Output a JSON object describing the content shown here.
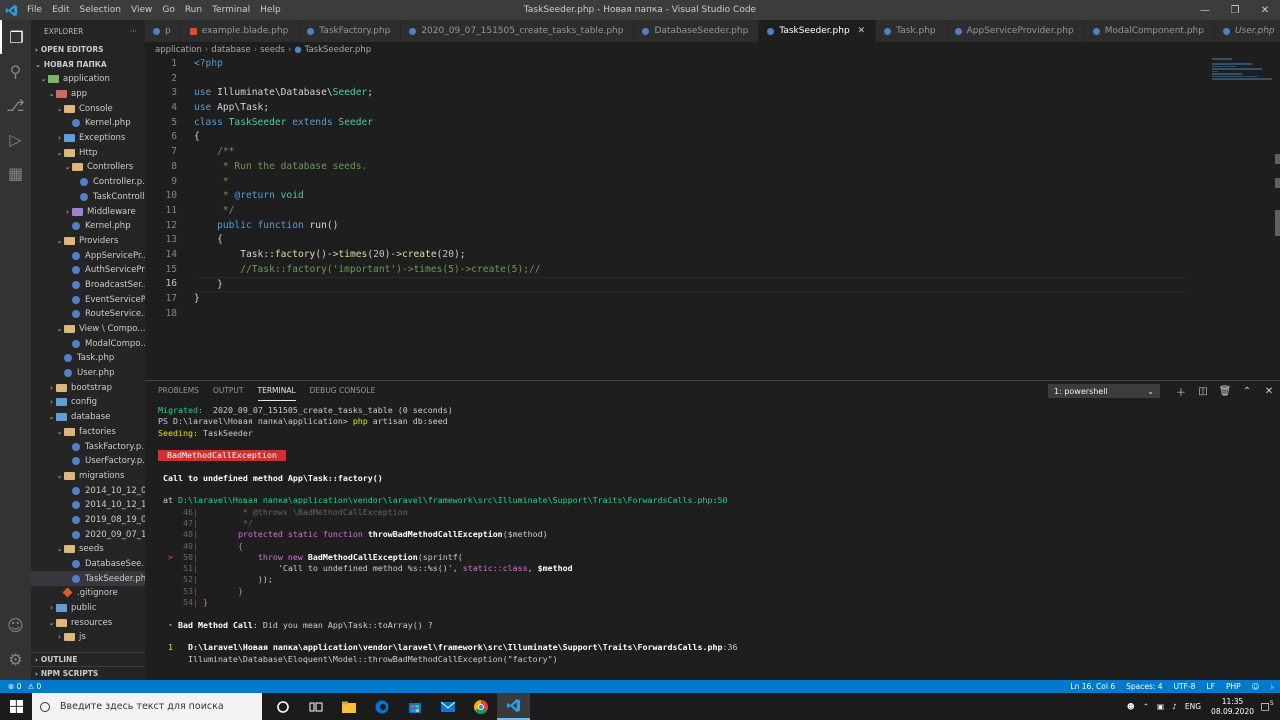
{
  "titlebar": {
    "menu": [
      "File",
      "Edit",
      "Selection",
      "View",
      "Go",
      "Run",
      "Terminal",
      "Help"
    ],
    "title": "TaskSeeder.php - Новая папка - Visual Studio Code"
  },
  "sidebar": {
    "header": "EXPLORER",
    "open_editors": "OPEN EDITORS",
    "root": "НОВАЯ ПАПКА",
    "tree": [
      {
        "label": "application",
        "depth": 1,
        "kind": "folder-green",
        "chev": "⌄"
      },
      {
        "label": "app",
        "depth": 2,
        "kind": "folder-red",
        "chev": "⌄"
      },
      {
        "label": "Console",
        "depth": 3,
        "kind": "folder",
        "chev": "⌄"
      },
      {
        "label": "Kernel.php",
        "depth": 4,
        "kind": "php",
        "chev": ""
      },
      {
        "label": "Exceptions",
        "depth": 3,
        "kind": "folder-blue",
        "chev": "›"
      },
      {
        "label": "Http",
        "depth": 3,
        "kind": "folder",
        "chev": "⌄"
      },
      {
        "label": "Controllers",
        "depth": 4,
        "kind": "folder",
        "chev": "⌄"
      },
      {
        "label": "Controller.p...",
        "depth": 5,
        "kind": "php",
        "chev": ""
      },
      {
        "label": "TaskControll...",
        "depth": 5,
        "kind": "php",
        "chev": ""
      },
      {
        "label": "Middleware",
        "depth": 4,
        "kind": "folder-purple",
        "chev": "›"
      },
      {
        "label": "Kernel.php",
        "depth": 4,
        "kind": "php",
        "chev": ""
      },
      {
        "label": "Providers",
        "depth": 3,
        "kind": "folder",
        "chev": "⌄"
      },
      {
        "label": "AppServicePr...",
        "depth": 4,
        "kind": "php",
        "chev": ""
      },
      {
        "label": "AuthServicePr...",
        "depth": 4,
        "kind": "php",
        "chev": ""
      },
      {
        "label": "BroadcastSer...",
        "depth": 4,
        "kind": "php",
        "chev": ""
      },
      {
        "label": "EventServiceP...",
        "depth": 4,
        "kind": "php",
        "chev": ""
      },
      {
        "label": "RouteService...",
        "depth": 4,
        "kind": "php",
        "chev": ""
      },
      {
        "label": "View \\ Compo...",
        "depth": 3,
        "kind": "folder",
        "chev": "⌄"
      },
      {
        "label": "ModalCompo...",
        "depth": 4,
        "kind": "php",
        "chev": ""
      },
      {
        "label": "Task.php",
        "depth": 3,
        "kind": "php",
        "chev": ""
      },
      {
        "label": "User.php",
        "depth": 3,
        "kind": "php",
        "chev": ""
      },
      {
        "label": "bootstrap",
        "depth": 2,
        "kind": "folder",
        "chev": "›"
      },
      {
        "label": "config",
        "depth": 2,
        "kind": "folder-blue",
        "chev": "›"
      },
      {
        "label": "database",
        "depth": 2,
        "kind": "folder-blue",
        "chev": "⌄"
      },
      {
        "label": "factories",
        "depth": 3,
        "kind": "folder",
        "chev": "⌄"
      },
      {
        "label": "TaskFactory.p...",
        "depth": 4,
        "kind": "php",
        "chev": ""
      },
      {
        "label": "UserFactory.p...",
        "depth": 4,
        "kind": "php",
        "chev": ""
      },
      {
        "label": "migrations",
        "depth": 3,
        "kind": "folder",
        "chev": "⌄"
      },
      {
        "label": "2014_10_12_0...",
        "depth": 4,
        "kind": "php",
        "chev": ""
      },
      {
        "label": "2014_10_12_1...",
        "depth": 4,
        "kind": "php",
        "chev": ""
      },
      {
        "label": "2019_08_19_0...",
        "depth": 4,
        "kind": "php",
        "chev": ""
      },
      {
        "label": "2020_09_07_1...",
        "depth": 4,
        "kind": "php",
        "chev": ""
      },
      {
        "label": "seeds",
        "depth": 3,
        "kind": "folder",
        "chev": "⌄"
      },
      {
        "label": "DatabaseSee...",
        "depth": 4,
        "kind": "php",
        "chev": ""
      },
      {
        "label": "TaskSeeder.php",
        "depth": 4,
        "kind": "php",
        "chev": "",
        "selected": true
      },
      {
        "label": ".gitignore",
        "depth": 3,
        "kind": "git",
        "chev": ""
      },
      {
        "label": "public",
        "depth": 2,
        "kind": "folder-blue",
        "chev": "›"
      },
      {
        "label": "resources",
        "depth": 2,
        "kind": "folder",
        "chev": "⌄"
      },
      {
        "label": "js",
        "depth": 3,
        "kind": "folder",
        "chev": "›"
      }
    ],
    "outline": "OUTLINE",
    "npm": "NPM SCRIPTS"
  },
  "tabs": [
    {
      "label": "p",
      "kind": "php"
    },
    {
      "label": "example.blade.php",
      "kind": "blade"
    },
    {
      "label": "TaskFactory.php",
      "kind": "php"
    },
    {
      "label": "2020_09_07_151505_create_tasks_table.php",
      "kind": "php"
    },
    {
      "label": "DatabaseSeeder.php",
      "kind": "php"
    },
    {
      "label": "TaskSeeder.php",
      "kind": "php",
      "active": true
    },
    {
      "label": "Task.php",
      "kind": "php"
    },
    {
      "label": "AppServiceProvider.php",
      "kind": "php"
    },
    {
      "label": "ModalComponent.php",
      "kind": "php"
    },
    {
      "label": "User.php",
      "kind": "php",
      "italic": true
    }
  ],
  "breadcrumb": [
    "application",
    "database",
    "seeds",
    "TaskSeeder.php"
  ],
  "editor": {
    "current_line": 16,
    "lines": [
      [
        [
          "tk-tag",
          "<?php"
        ]
      ],
      [],
      [
        [
          "tk-kw",
          "use "
        ],
        [
          "tk-pl",
          "Illuminate\\Database\\"
        ],
        [
          "tk-cls",
          "Seeder"
        ],
        [
          "tk-pl",
          ";"
        ]
      ],
      [
        [
          "tk-kw",
          "use "
        ],
        [
          "tk-pl",
          "App\\Task;"
        ]
      ],
      [
        [
          "tk-kw",
          "class "
        ],
        [
          "tk-cls",
          "TaskSeeder "
        ],
        [
          "tk-kw",
          "extends "
        ],
        [
          "tk-cls",
          "Seeder"
        ]
      ],
      [
        [
          "tk-pl",
          "{"
        ]
      ],
      [
        [
          "tk-cm",
          "    /**"
        ]
      ],
      [
        [
          "tk-cm",
          "     * Run the database seeds."
        ]
      ],
      [
        [
          "tk-cm",
          "     *"
        ]
      ],
      [
        [
          "tk-cm",
          "     * "
        ],
        [
          "tk-kw",
          "@return "
        ],
        [
          "tk-cls",
          "void"
        ]
      ],
      [
        [
          "tk-cm",
          "     */"
        ]
      ],
      [
        [
          "tk-kw",
          "    public function "
        ],
        [
          "tk-fn",
          "run"
        ],
        [
          "tk-pl",
          "()"
        ]
      ],
      [
        [
          "tk-pl",
          "    {"
        ]
      ],
      [
        [
          "tk-pl",
          "        Task::"
        ],
        [
          "tk-fn",
          "factory"
        ],
        [
          "tk-pl",
          "()->"
        ],
        [
          "tk-fn",
          "times"
        ],
        [
          "tk-pl",
          "("
        ],
        [
          "tk-num",
          "20"
        ],
        [
          "tk-pl",
          ")->"
        ],
        [
          "tk-fn",
          "create"
        ],
        [
          "tk-pl",
          "("
        ],
        [
          "tk-num",
          "20"
        ],
        [
          "tk-pl",
          ");"
        ]
      ],
      [
        [
          "tk-cm",
          "        //Task::factory('important')->times(5)->create(5);//"
        ]
      ],
      [
        [
          "tk-pl",
          "    }"
        ]
      ],
      [
        [
          "tk-pl",
          "}"
        ]
      ],
      []
    ]
  },
  "panel": {
    "tabs": [
      "PROBLEMS",
      "OUTPUT",
      "TERMINAL",
      "DEBUG CONSOLE"
    ],
    "active_tab": "TERMINAL",
    "terminal_select": "1: powershell",
    "lines": [
      [
        [
          "t-green",
          "Migrated:  "
        ],
        [
          "",
          "2020_09_07_151505_create_tasks_table (0 seconds)"
        ]
      ],
      [
        [
          "",
          "PS D:\\laravel\\Новая папка\\application> "
        ],
        [
          "t-yellow",
          "php"
        ],
        [
          "",
          " artisan db:seed"
        ]
      ],
      [
        [
          "t-yellow",
          "Seeding:"
        ],
        [
          "",
          " TaskSeeder"
        ]
      ],
      [],
      [
        [
          "badge",
          " BadMethodCallException "
        ]
      ],
      [],
      [
        [
          "t-bold",
          " Call to undefined method App\\Task::factory()"
        ]
      ],
      [],
      [
        [
          "",
          " at "
        ],
        [
          "t-green",
          "D:\\laravel\\Новая папка\\application\\vendor\\laravel\\framework\\src\\Illuminate\\Support\\Traits\\ForwardsCalls.php"
        ],
        [
          "",
          ":"
        ],
        [
          "t-green",
          "50"
        ]
      ],
      [
        [
          "t-dim",
          "     46|         * @throws \\BadMethodCallException"
        ]
      ],
      [
        [
          "t-dim",
          "     47|         */"
        ]
      ],
      [
        [
          "t-dim",
          "     48|        "
        ],
        [
          "t-pink",
          "protected static function "
        ],
        [
          "t-bold",
          "throwBadMethodCallException"
        ],
        [
          "",
          "($method)"
        ]
      ],
      [
        [
          "t-dim",
          "     49|        "
        ],
        [
          "t-pink",
          "{"
        ]
      ],
      [
        [
          "t-red",
          "  >"
        ],
        [
          "t-dim",
          "  50|            "
        ],
        [
          "t-pink",
          "throw new "
        ],
        [
          "t-bold",
          "BadMethodCallException"
        ],
        [
          "",
          "(sprintf("
        ]
      ],
      [
        [
          "t-dim",
          "     51|                "
        ],
        [
          "",
          "'Call to undefined method %s::%s()', "
        ],
        [
          "t-pink",
          "static::class"
        ],
        [
          "",
          ", "
        ],
        [
          "t-bold",
          "$method"
        ]
      ],
      [
        [
          "t-dim",
          "     52|            "
        ],
        [
          "",
          "));"
        ]
      ],
      [
        [
          "t-dim",
          "     53|        "
        ],
        [
          "t-pink",
          "}"
        ]
      ],
      [
        [
          "t-dim",
          "     54| "
        ],
        [
          "t-pink",
          "}"
        ]
      ],
      [],
      [
        [
          "t-blue",
          "  • "
        ],
        [
          "t-bold",
          "Bad Method Call"
        ],
        [
          "",
          ": Did you mean App\\Task::toArray() ?"
        ]
      ],
      [],
      [
        [
          "t-yellow",
          "  1   "
        ],
        [
          "t-bold",
          "D:\\laravel\\Новая папка\\application\\vendor\\laravel\\framework\\src\\Illuminate\\Support\\Traits\\ForwardsCalls.php"
        ],
        [
          "",
          ":36"
        ]
      ],
      [
        [
          "",
          "      Illuminate\\Database\\Eloquent\\Model::throwBadMethodCallException(\"factory\")"
        ]
      ]
    ]
  },
  "status": {
    "errors": "⊗ 0",
    "warnings": "⚠ 0",
    "position": "Ln 16, Col 6",
    "spaces": "Spaces: 4",
    "encoding": "UTF-8",
    "eol": "LF",
    "language": "PHP"
  },
  "taskbar": {
    "search_placeholder": "Введите здесь текст для поиска",
    "lang": "ENG",
    "time": "11:35",
    "date": "08.09.2020",
    "notifications": "5"
  }
}
